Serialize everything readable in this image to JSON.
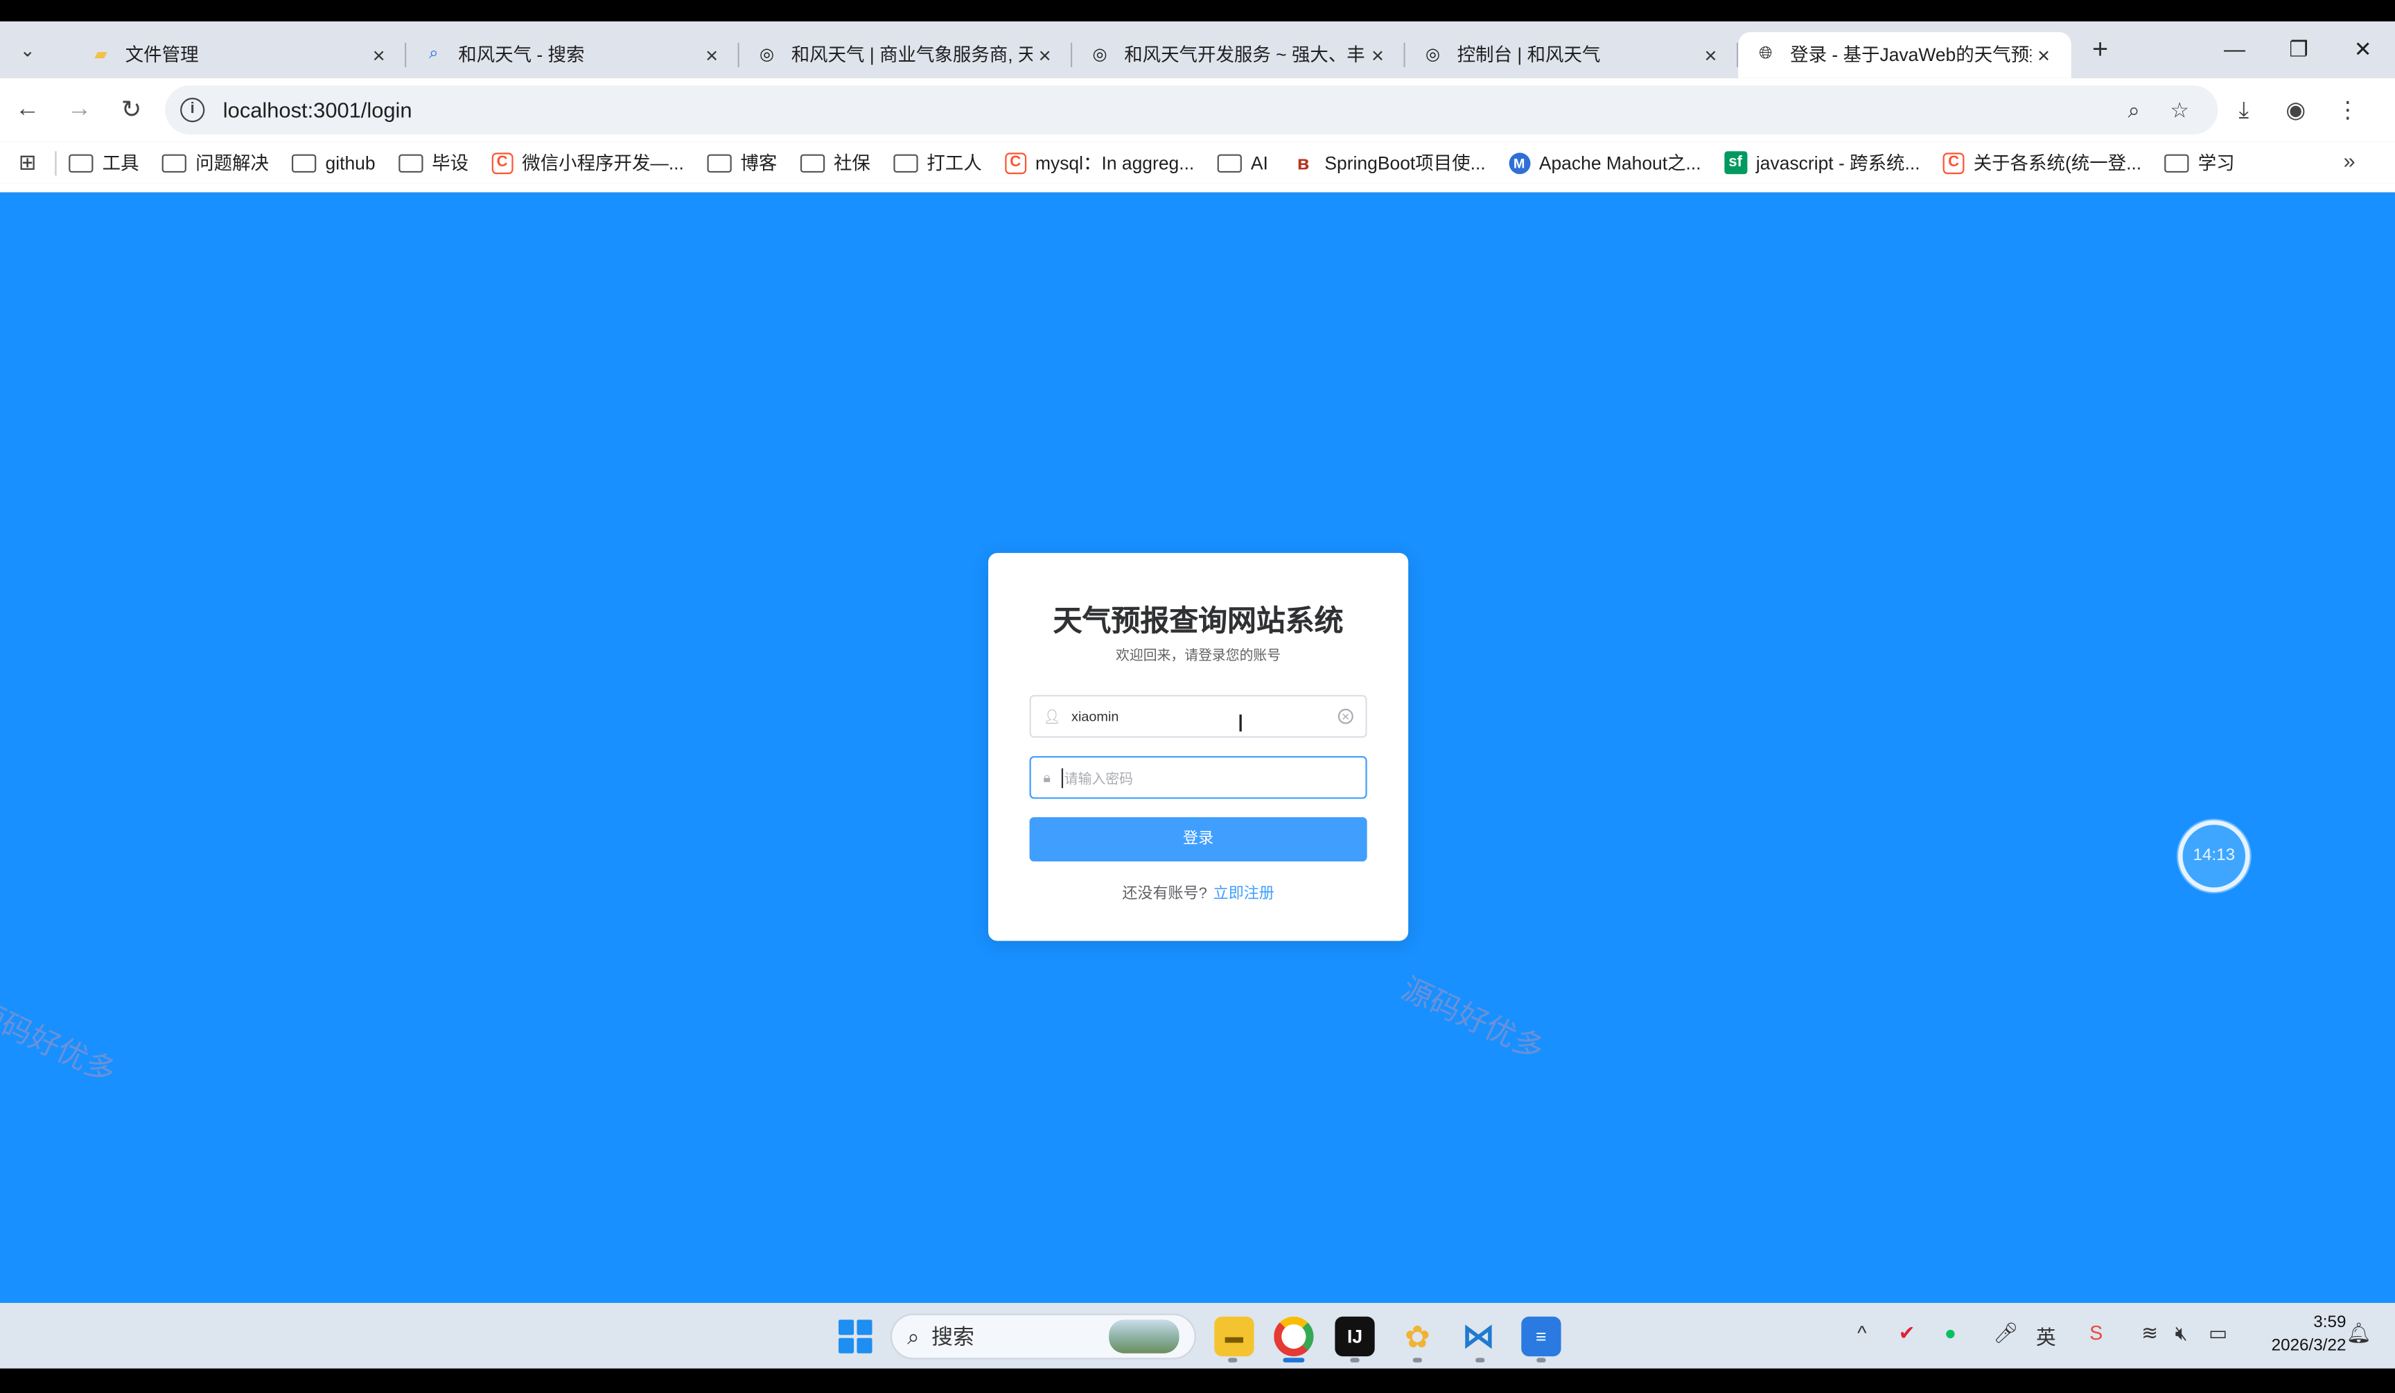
{
  "browser": {
    "tabs": [
      {
        "title": "文件管理",
        "icon": "folder-icon"
      },
      {
        "title": "和风天气 - 搜索",
        "icon": "search-icon"
      },
      {
        "title": "和风天气 | 商业气象服务商, 天",
        "icon": "qweather-icon"
      },
      {
        "title": "和风天气开发服务 ~ 强大、丰",
        "icon": "qweather-icon"
      },
      {
        "title": "控制台 | 和风天气",
        "icon": "qweather-icon"
      },
      {
        "title": "登录 - 基于JavaWeb的天气预报",
        "icon": "globe-icon",
        "active": true
      }
    ],
    "new_tab_glyph": "+",
    "url": "localhost:3001/login"
  },
  "bookmarks": [
    {
      "label": "工具",
      "type": "folder"
    },
    {
      "label": "问题解决",
      "type": "folder"
    },
    {
      "label": "github",
      "type": "folder"
    },
    {
      "label": "毕设",
      "type": "folder"
    },
    {
      "label": "微信小程序开发—...",
      "type": "csdn"
    },
    {
      "label": "博客",
      "type": "folder"
    },
    {
      "label": "社保",
      "type": "folder"
    },
    {
      "label": "打工人",
      "type": "folder"
    },
    {
      "label": "mysql：In aggreg...",
      "type": "csdn"
    },
    {
      "label": "AI",
      "type": "folder"
    },
    {
      "label": "SpringBoot项目使...",
      "type": "brand"
    },
    {
      "label": "Apache Mahout之...",
      "type": "mahout"
    },
    {
      "label": "javascript - 跨系统...",
      "type": "sf"
    },
    {
      "label": "关于各系统(统一登...",
      "type": "csdn"
    },
    {
      "label": "学习",
      "type": "folder"
    }
  ],
  "login": {
    "title": "天气预报查询网站系统",
    "subtitle": "欢迎回来，请登录您的账号",
    "username_value": "xiaomin",
    "password_placeholder": "请输入密码",
    "login_button": "登录",
    "register_prompt": "还没有账号?",
    "register_link": "立即注册"
  },
  "overlay": {
    "timer": "14:13",
    "watermark": "源码好优多"
  },
  "taskbar": {
    "search_placeholder": "搜索",
    "ime_label": "英",
    "time": "3:59",
    "date": "2026/3/22"
  },
  "colors": {
    "page_background": "#1890ff",
    "primary_button": "#409eff",
    "link": "#409eff"
  }
}
